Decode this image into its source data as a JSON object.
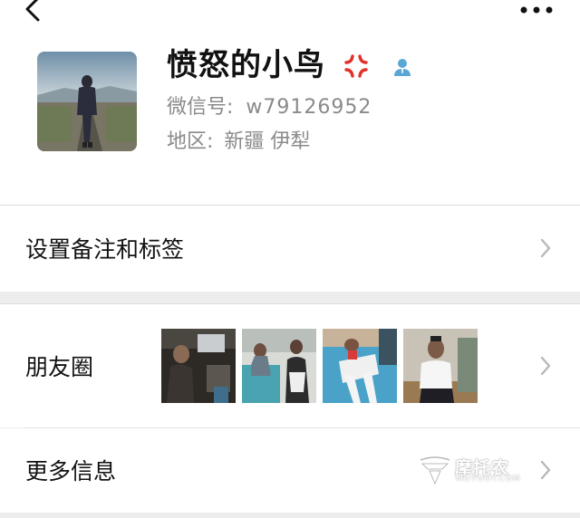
{
  "header": {
    "back_icon": "chevron-left-icon",
    "more_icon": "more-dots-icon"
  },
  "profile": {
    "avatar_icon": "avatar-photo",
    "name": "愤怒的小鸟",
    "name_emoji_icon": "anger-symbol-icon",
    "contact_badge_icon": "contact-person-icon",
    "wechat_id_label": "微信号:",
    "wechat_id_value": "w79126952",
    "region_label": "地区:",
    "region_value": "新疆 伊犁"
  },
  "cells": {
    "remark_tags": "设置备注和标签",
    "moments": "朋友圈",
    "more_info": "更多信息"
  },
  "moments_thumbnails": [
    "photo-thumbnail",
    "photo-thumbnail",
    "photo-thumbnail",
    "photo-thumbnail"
  ],
  "watermark": {
    "text": "摩托农",
    "sub": "MOTOOY.COM"
  },
  "colors": {
    "background": "#ededed",
    "card": "#ffffff",
    "secondary_text": "#8a8a8a",
    "contact_icon_blue": "#5aa7d6",
    "anger_red": "#e0322c",
    "chevron": "#b8b8b8"
  }
}
